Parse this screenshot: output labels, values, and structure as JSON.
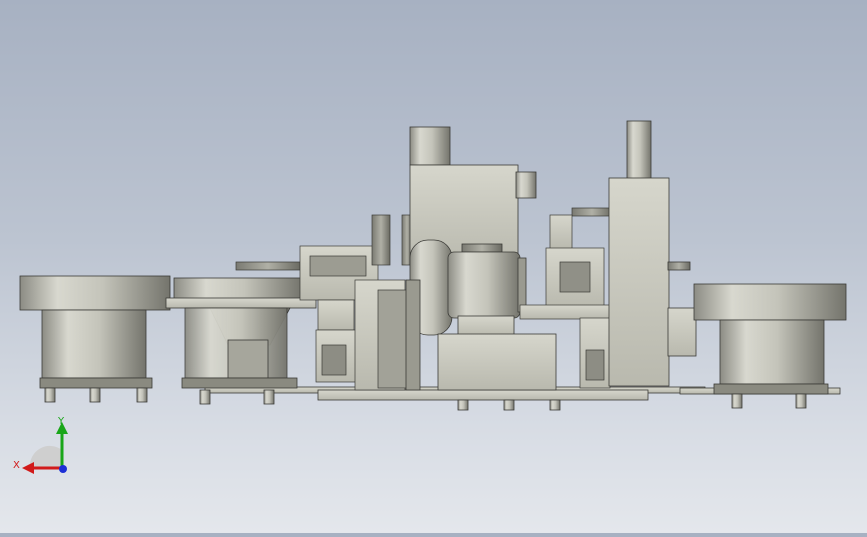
{
  "viewport": {
    "background_top": "#a7b1c2",
    "background_bottom": "#e4e7ec",
    "model_description_hidden": ""
  },
  "triad": {
    "x_label": "X",
    "y_label": "Y",
    "x_color": "#d11a1a",
    "y_color": "#19a619",
    "z_color": "#1c2fd6"
  },
  "colors": {
    "metal_light": "#d9d9cf",
    "metal_mid": "#b6b6ab",
    "metal_dark": "#6f6f66",
    "outline": "#3a3a36"
  }
}
